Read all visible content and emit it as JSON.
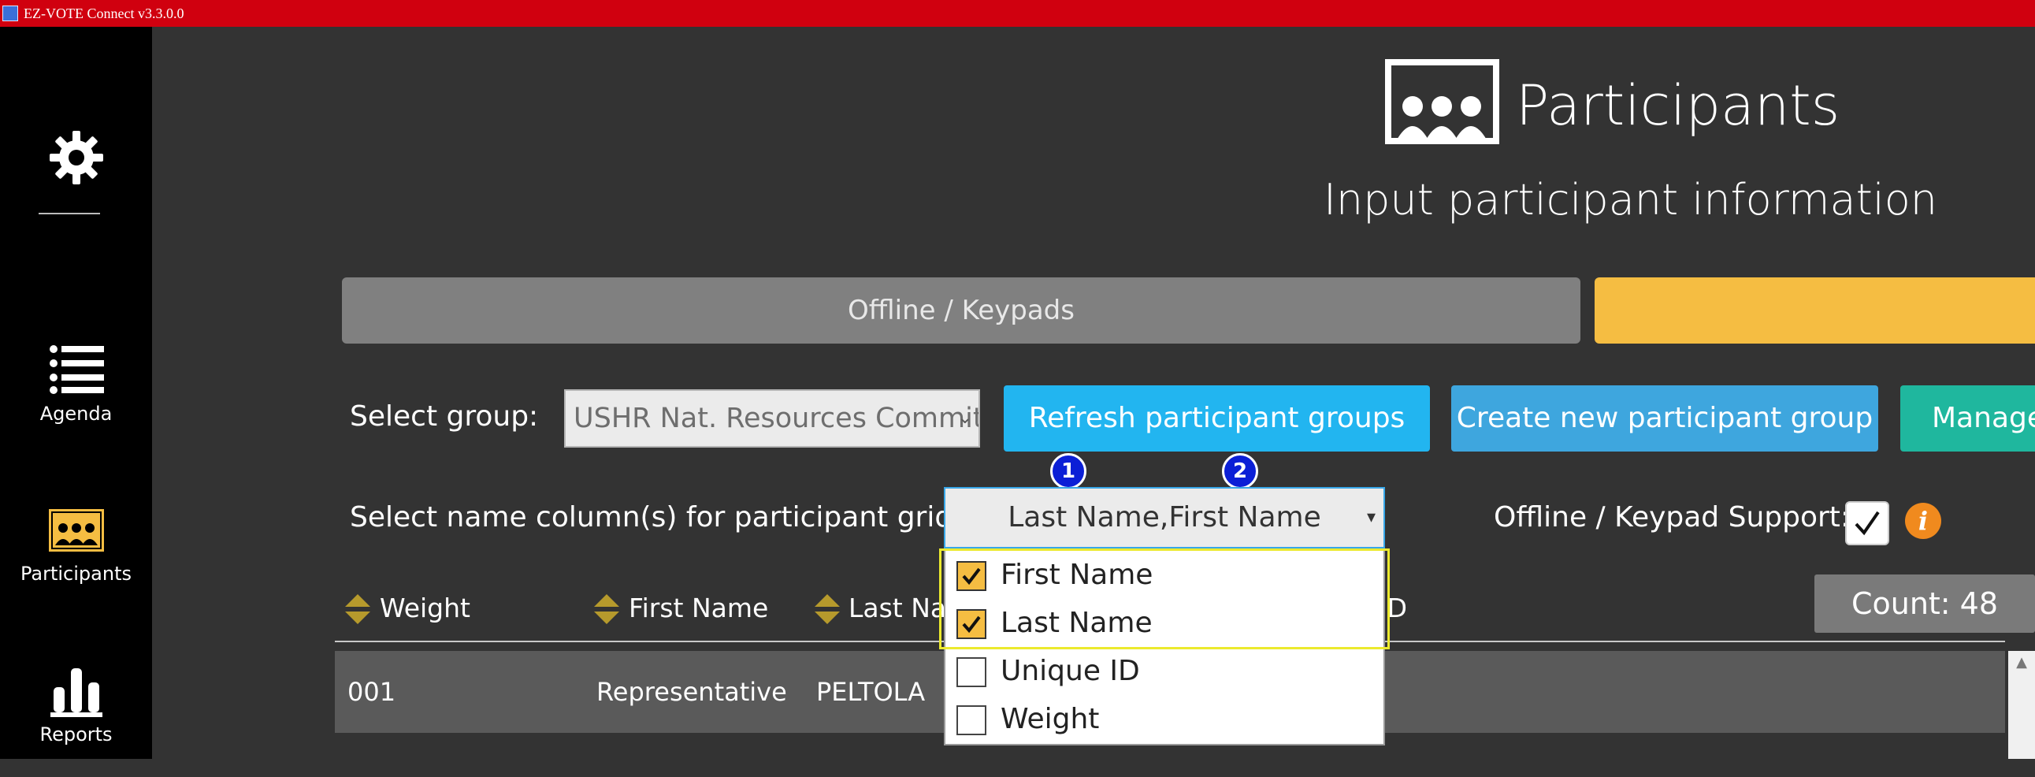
{
  "window": {
    "title": "EZ-VOTE Connect v3.3.0.0"
  },
  "sidebar": {
    "items": [
      {
        "label": "",
        "icon": "gear-icon"
      },
      {
        "label": "Agenda",
        "icon": "list-icon"
      },
      {
        "label": "Participants",
        "icon": "participants-icon",
        "active": true
      },
      {
        "label": "Reports",
        "icon": "bar-chart-icon"
      }
    ]
  },
  "header": {
    "title": "Participants",
    "subtitle": "Input participant information"
  },
  "tabs": [
    {
      "label": "Offline / Keypads",
      "active": false
    },
    {
      "label": "",
      "active": true
    }
  ],
  "group": {
    "label": "Select group:",
    "selected": "USHR Nat. Resources Committee",
    "refresh_label": "Refresh participant groups",
    "create_label": "Create new participant group",
    "manage_label": "Manage"
  },
  "name_columns": {
    "label": "Select name column(s) for participant grid:",
    "value": "Last Name,First Name",
    "options": [
      {
        "label": "First Name",
        "checked": true
      },
      {
        "label": "Last Name",
        "checked": true
      },
      {
        "label": "Unique ID",
        "checked": false
      },
      {
        "label": "Weight",
        "checked": false
      }
    ],
    "annotations": [
      "1",
      "2"
    ]
  },
  "offline_support": {
    "label": "Offline / Keypad Support:",
    "checked": true
  },
  "grid": {
    "count_label": "Count: 48",
    "columns": [
      "Weight",
      "First Name",
      "Last Name",
      "Unique ID"
    ],
    "rows": [
      {
        "weight": "001",
        "first_name": "Representative",
        "last_name": "PELTOLA"
      }
    ]
  },
  "colors": {
    "titlebar": "#d0000f",
    "accent_yellow": "#f5bd42",
    "refresh_button": "#22b5f0",
    "create_button": "#3ea6de",
    "manage_button": "#1fb79e",
    "background": "#333333",
    "sidebar": "#000000"
  }
}
